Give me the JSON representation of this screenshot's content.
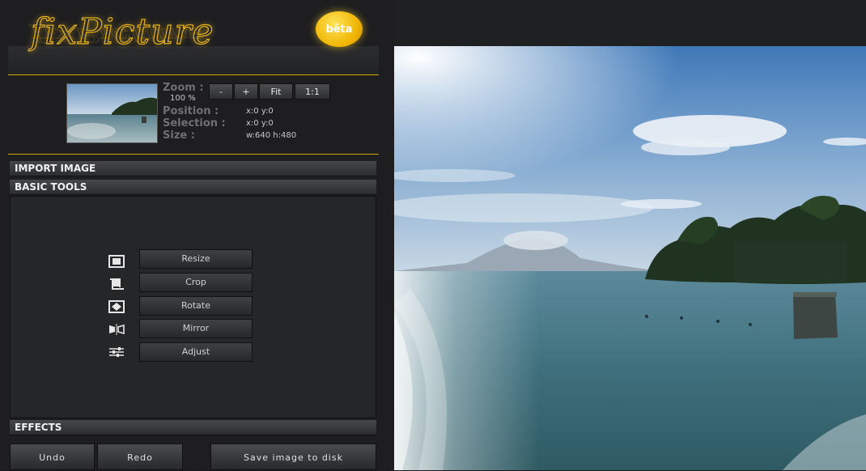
{
  "app": {
    "logo_text": "fixPicture",
    "beta_badge": "bêta"
  },
  "colors": {
    "accent": "#d4a400",
    "panel_bg": "#1e1e20",
    "button_bg": "#3e4043"
  },
  "info": {
    "zoom_label": "Zoom :",
    "zoom_value": "100 %",
    "position_label": "Position :",
    "position_value": "x:0 y:0",
    "selection_label": "Selection :",
    "selection_value": "x:0 y:0",
    "size_label": "Size :",
    "size_value": "w:640 h:480"
  },
  "zoom_buttons": {
    "minus": "-",
    "plus": "+",
    "fit": "Fit",
    "one_to_one": "1:1"
  },
  "sections": {
    "import": "IMPORT IMAGE",
    "basic": "BASIC TOOLS",
    "effects": "EFFECTS"
  },
  "tools": [
    {
      "label": "Resize",
      "icon": "resize-icon"
    },
    {
      "label": "Crop",
      "icon": "crop-icon"
    },
    {
      "label": "Rotate",
      "icon": "rotate-icon"
    },
    {
      "label": "Mirror",
      "icon": "mirror-icon"
    },
    {
      "label": "Adjust",
      "icon": "adjust-icon"
    }
  ],
  "actions": {
    "undo": "Undo",
    "redo": "Redo",
    "save": "Save image to disk"
  }
}
